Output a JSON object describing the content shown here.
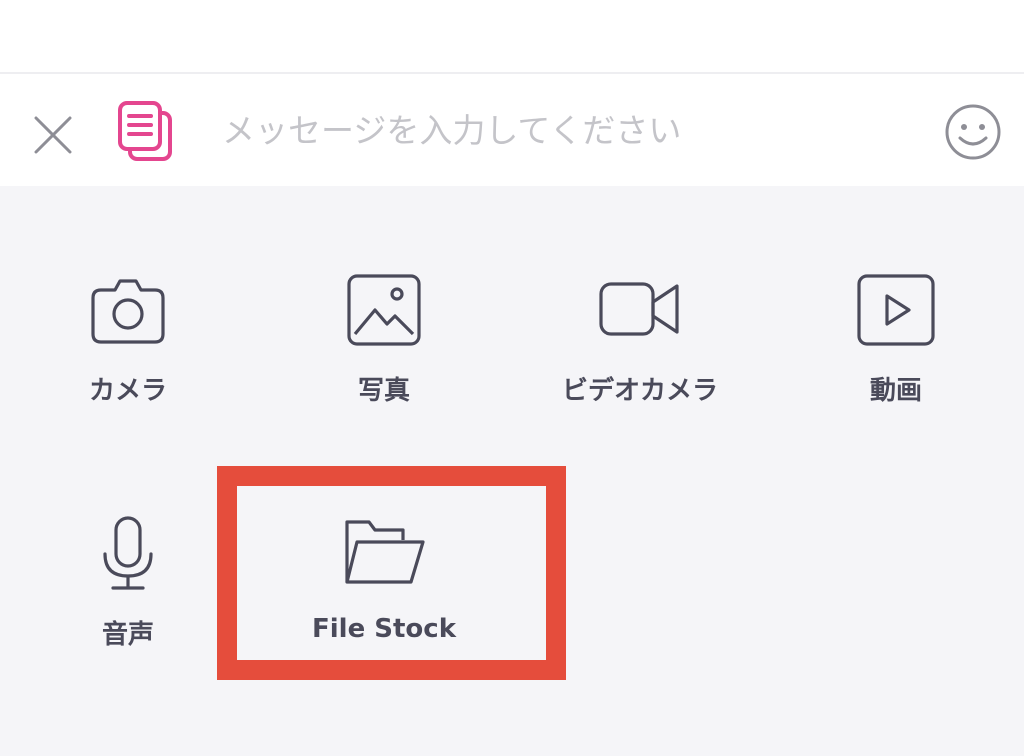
{
  "composer": {
    "placeholder": "メッセージを入力してください",
    "close_icon": "close-icon",
    "stamp_icon": "stack-document-icon",
    "emoji_icon": "smiley-icon",
    "accent_color": "#e4468f"
  },
  "menu": {
    "items": [
      {
        "label": "カメラ",
        "icon": "camera-icon"
      },
      {
        "label": "写真",
        "icon": "photo-icon"
      },
      {
        "label": "ビデオカメラ",
        "icon": "video-camera-icon"
      },
      {
        "label": "動画",
        "icon": "play-video-icon"
      },
      {
        "label": "音声",
        "icon": "microphone-icon"
      },
      {
        "label": "File Stock",
        "icon": "folder-open-icon"
      }
    ],
    "icon_color": "#4a4a5a"
  },
  "highlight": {
    "color": "#e54d3c",
    "target": "File Stock"
  }
}
